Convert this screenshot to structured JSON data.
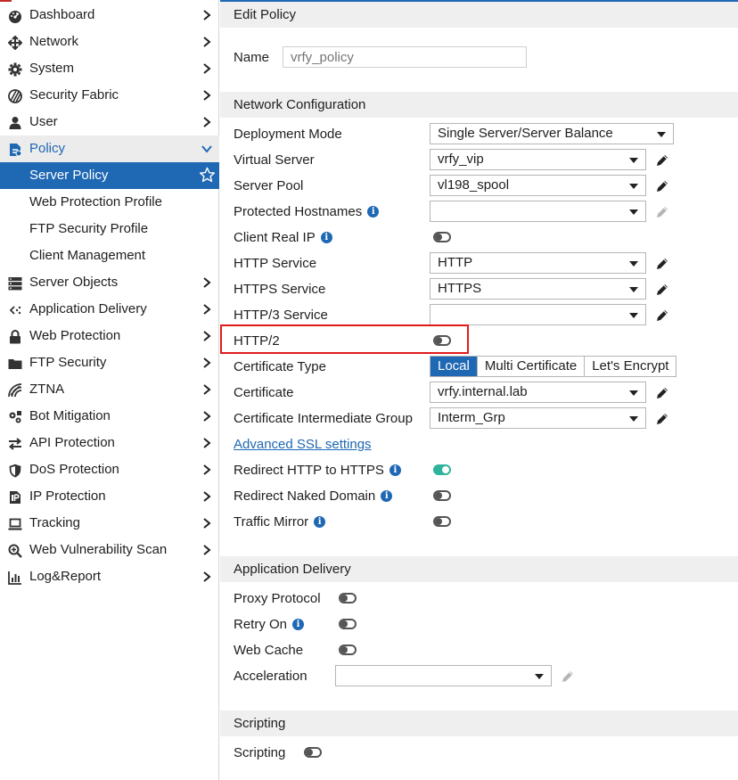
{
  "sidebar": {
    "items": [
      {
        "label": "Dashboard",
        "icon": "dashboard-icon"
      },
      {
        "label": "Network",
        "icon": "network-icon"
      },
      {
        "label": "System",
        "icon": "gear-icon"
      },
      {
        "label": "Security Fabric",
        "icon": "security-fabric-icon"
      },
      {
        "label": "User",
        "icon": "user-icon"
      },
      {
        "label": "Policy",
        "icon": "policy-icon"
      },
      {
        "label": "Server Objects",
        "icon": "server-objects-icon"
      },
      {
        "label": "Application Delivery",
        "icon": "application-delivery-icon"
      },
      {
        "label": "Web Protection",
        "icon": "lock-icon"
      },
      {
        "label": "FTP Security",
        "icon": "folder-icon"
      },
      {
        "label": "ZTNA",
        "icon": "ztna-icon"
      },
      {
        "label": "Bot Mitigation",
        "icon": "bot-mitigation-icon"
      },
      {
        "label": "API Protection",
        "icon": "api-protection-icon"
      },
      {
        "label": "DoS Protection",
        "icon": "shield-icon"
      },
      {
        "label": "IP Protection",
        "icon": "ip-protection-icon"
      },
      {
        "label": "Tracking",
        "icon": "laptop-icon"
      },
      {
        "label": "Web Vulnerability Scan",
        "icon": "magnifier-icon"
      },
      {
        "label": "Log&Report",
        "icon": "chart-icon"
      }
    ],
    "policy_sub": [
      {
        "label": "Server Policy"
      },
      {
        "label": "Web Protection Profile"
      },
      {
        "label": "FTP Security Profile"
      },
      {
        "label": "Client Management"
      }
    ]
  },
  "edit_policy": {
    "title": "Edit Policy",
    "name_label": "Name",
    "name_placeholder": "vrfy_policy"
  },
  "network_config": {
    "title": "Network Configuration",
    "deployment_mode": {
      "label": "Deployment Mode",
      "value": "Single Server/Server Balance"
    },
    "virtual_server": {
      "label": "Virtual Server",
      "value": "vrfy_vip"
    },
    "server_pool": {
      "label": "Server Pool",
      "value": "vl198_spool"
    },
    "protected_hostnames": {
      "label": "Protected Hostnames",
      "value": ""
    },
    "client_real_ip": {
      "label": "Client Real IP",
      "on": false
    },
    "http_service": {
      "label": "HTTP Service",
      "value": "HTTP"
    },
    "https_service": {
      "label": "HTTPS Service",
      "value": "HTTPS"
    },
    "http3_service": {
      "label": "HTTP/3 Service",
      "value": ""
    },
    "http2": {
      "label": "HTTP/2",
      "on": false
    },
    "certificate_type": {
      "label": "Certificate Type",
      "options": [
        "Local",
        "Multi Certificate",
        "Let's Encrypt"
      ],
      "selected": "Local"
    },
    "certificate": {
      "label": "Certificate",
      "value": "vrfy.internal.lab"
    },
    "cert_intermediate_group": {
      "label": "Certificate Intermediate Group",
      "value": "Interm_Grp"
    },
    "advanced_ssl": "Advanced SSL settings",
    "redirect_http_https": {
      "label": "Redirect HTTP to HTTPS",
      "on": true
    },
    "redirect_naked_domain": {
      "label": "Redirect Naked Domain",
      "on": false
    },
    "traffic_mirror": {
      "label": "Traffic Mirror",
      "on": false
    }
  },
  "application_delivery": {
    "title": "Application Delivery",
    "proxy_protocol": {
      "label": "Proxy Protocol",
      "on": false
    },
    "retry_on": {
      "label": "Retry On",
      "on": false
    },
    "web_cache": {
      "label": "Web Cache",
      "on": false
    },
    "acceleration": {
      "label": "Acceleration",
      "value": ""
    }
  },
  "scripting": {
    "title": "Scripting",
    "scripting": {
      "label": "Scripting",
      "on": false
    }
  },
  "colors": {
    "accent": "#1f68b3",
    "toggle_on": "#2eb49a",
    "highlight": "#e01b1b"
  }
}
